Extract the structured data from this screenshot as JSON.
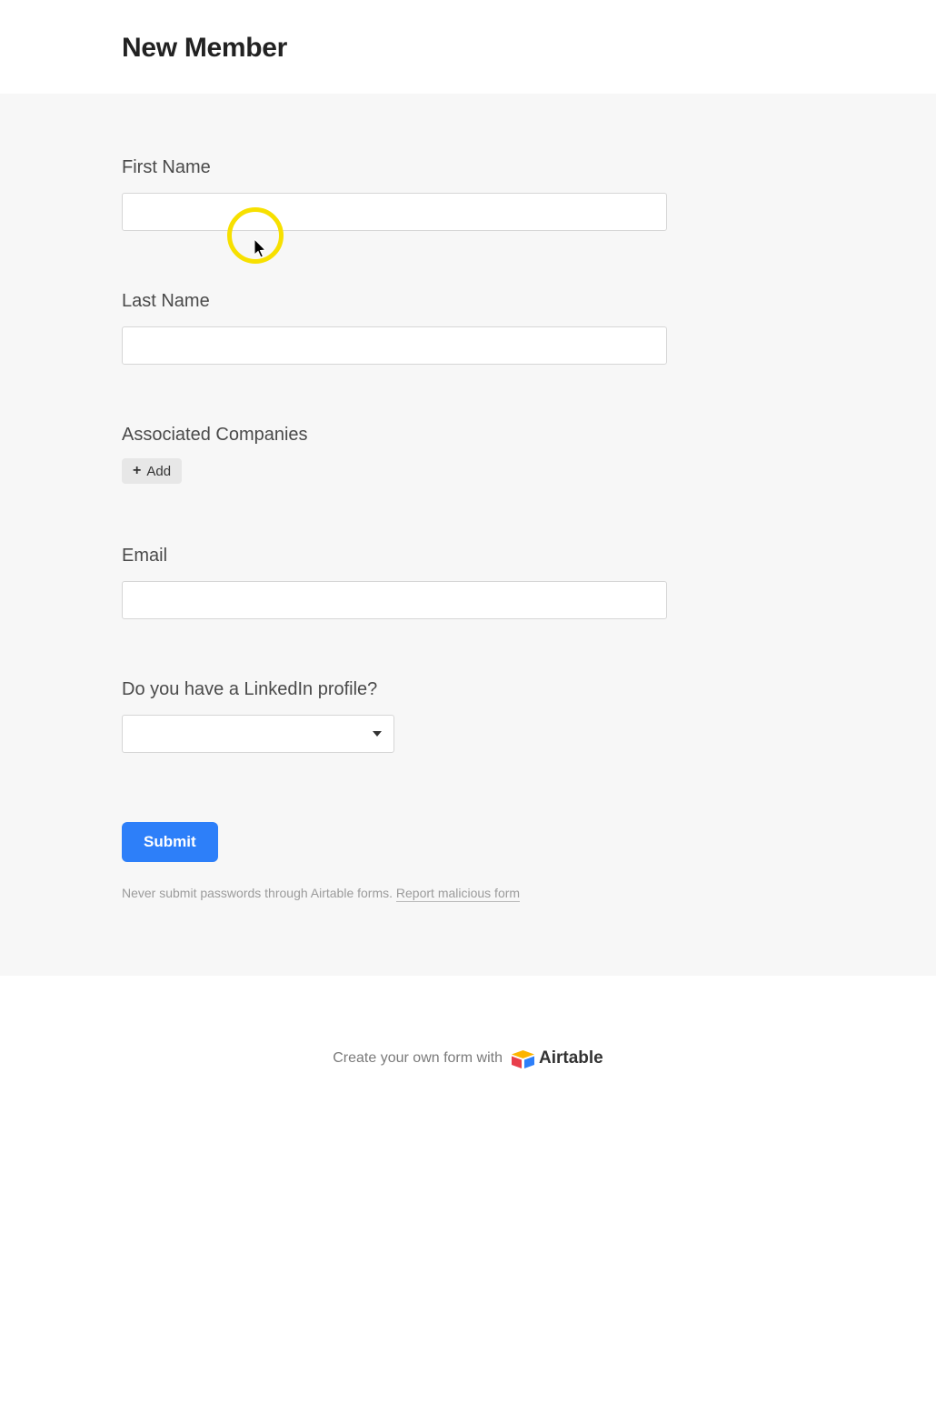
{
  "header": {
    "title": "New Member"
  },
  "form": {
    "fields": {
      "first_name": {
        "label": "First Name",
        "value": ""
      },
      "last_name": {
        "label": "Last Name",
        "value": ""
      },
      "associated_companies": {
        "label": "Associated Companies",
        "add_label": "Add"
      },
      "email": {
        "label": "Email",
        "value": ""
      },
      "linkedin": {
        "label": "Do you have a LinkedIn profile?",
        "value": ""
      }
    },
    "submit_label": "Submit",
    "disclaimer_text": "Never submit passwords through Airtable forms. ",
    "report_link": "Report malicious form"
  },
  "footer": {
    "prompt": "Create your own form with",
    "brand": "Airtable"
  }
}
